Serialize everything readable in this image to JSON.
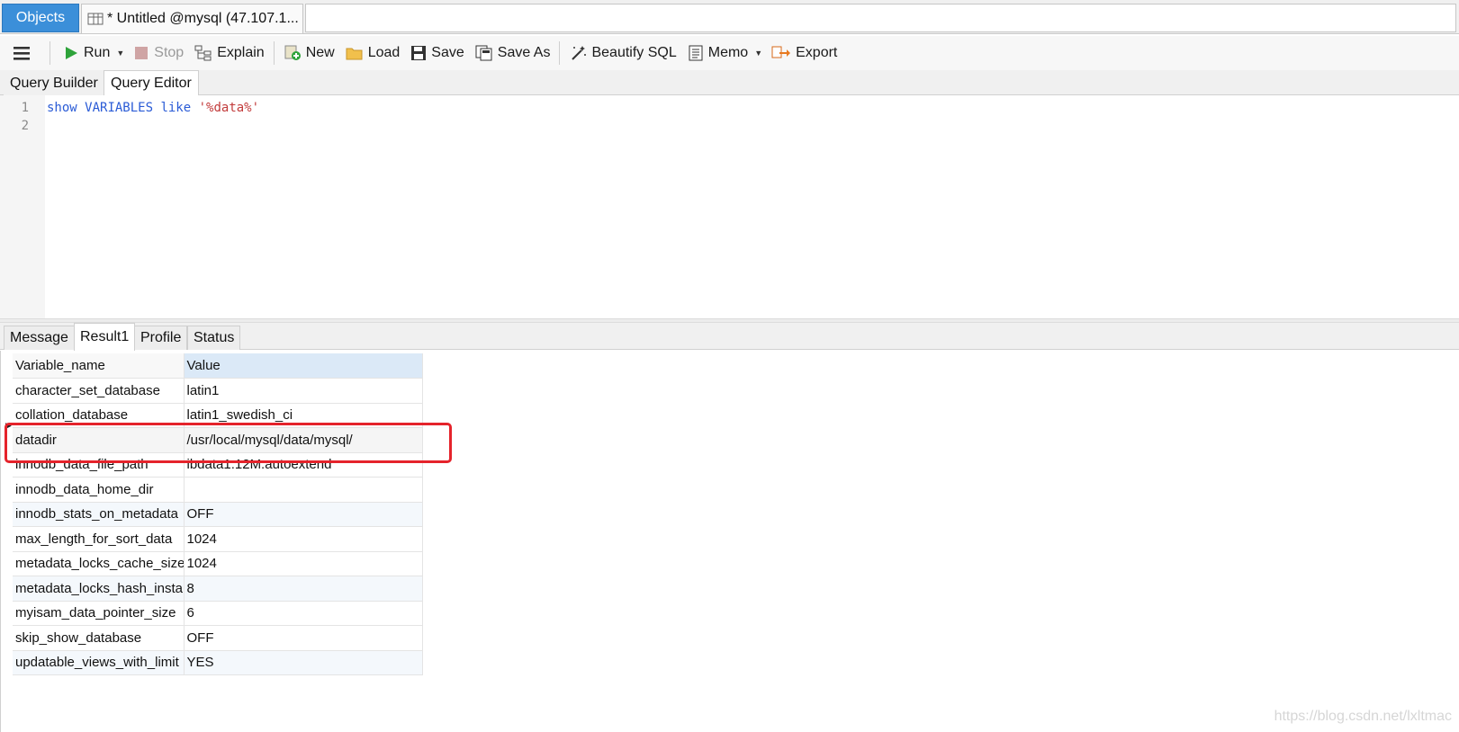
{
  "tabs": {
    "objects": "Objects",
    "query_tab": "* Untitled @mysql (47.107.1..."
  },
  "toolbar": {
    "menu_icon": "hamburger-icon",
    "run": "Run",
    "stop": "Stop",
    "explain": "Explain",
    "new": "New",
    "load": "Load",
    "save": "Save",
    "save_as": "Save As",
    "beautify": "Beautify SQL",
    "memo": "Memo",
    "export": "Export"
  },
  "editor_tabs": {
    "builder": "Query Builder",
    "editor": "Query Editor"
  },
  "editor": {
    "lines": [
      {
        "num": "1",
        "kw1": "show",
        "kw2": "VARIABLES",
        "kw3": "like",
        "str": "'%data%'"
      },
      {
        "num": "2"
      }
    ]
  },
  "result_tabs": {
    "message": "Message",
    "result1": "Result1",
    "profile": "Profile",
    "status": "Status"
  },
  "grid": {
    "headers": {
      "col1": "Variable_name",
      "col2": "Value"
    },
    "rows": [
      {
        "name": "character_set_database",
        "value": "latin1"
      },
      {
        "name": "collation_database",
        "value": "latin1_swedish_ci"
      },
      {
        "name": "datadir",
        "value": "/usr/local/mysql/data/mysql/"
      },
      {
        "name": "innodb_data_file_path",
        "value": "ibdata1:12M:autoextend"
      },
      {
        "name": "innodb_data_home_dir",
        "value": ""
      },
      {
        "name": "innodb_stats_on_metadata",
        "value": "OFF"
      },
      {
        "name": "max_length_for_sort_data",
        "value": "1024"
      },
      {
        "name": "metadata_locks_cache_size",
        "value": "1024"
      },
      {
        "name": "metadata_locks_hash_instances",
        "value": "8"
      },
      {
        "name": "myisam_data_pointer_size",
        "value": "6"
      },
      {
        "name": "skip_show_database",
        "value": "OFF"
      },
      {
        "name": "updatable_views_with_limit",
        "value": "YES"
      }
    ]
  },
  "watermark": "https://blog.csdn.net/lxltmac",
  "colors": {
    "accent": "#3b8fd9",
    "highlight": "#e5232b",
    "keyword": "#2a5bd6",
    "string": "#c23b3b"
  }
}
